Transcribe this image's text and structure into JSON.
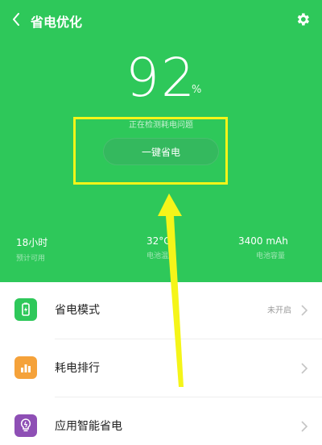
{
  "header": {
    "title": "省电优化",
    "bg_color": "#2ec85a"
  },
  "battery": {
    "percent": "92",
    "unit": "%",
    "status": "正在检测耗电问题"
  },
  "actions": {
    "one_key_label": "一键省电"
  },
  "stats": [
    {
      "value": "18小时",
      "label": "预计可用"
    },
    {
      "value": "32°C",
      "label": "电池温度"
    },
    {
      "value": "3400 mAh",
      "label": "电池容量"
    }
  ],
  "list": {
    "items": [
      {
        "label": "省电模式",
        "status": "未开启",
        "icon": "battery-mode-icon",
        "color": "#2ec85a"
      },
      {
        "label": "耗电排行",
        "status": "",
        "icon": "bar-chart-icon",
        "color": "#f5a23a"
      },
      {
        "label": "应用智能省电",
        "status": "",
        "icon": "lightbulb-icon",
        "color": "#8e4fb5"
      }
    ]
  },
  "annotation": {
    "box_color": "#f5f519",
    "arrow_color": "#f5f519"
  }
}
